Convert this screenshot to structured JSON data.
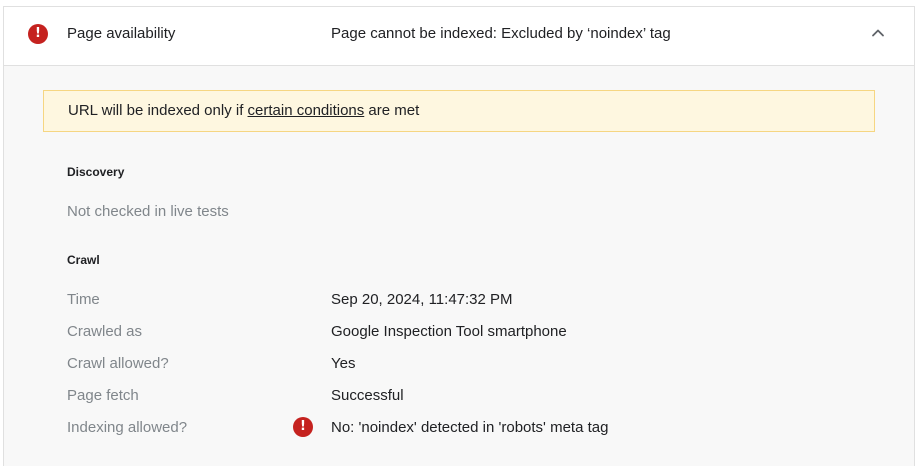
{
  "header": {
    "label": "Page availability",
    "status": "Page cannot be indexed: Excluded by ‘noindex’ tag",
    "icon": "error-icon",
    "collapse_icon": "chevron-up-icon"
  },
  "notice": {
    "prefix": "URL will be indexed only if ",
    "link": "certain conditions",
    "suffix": " are met"
  },
  "discovery": {
    "title": "Discovery",
    "note": "Not checked in live tests"
  },
  "crawl": {
    "title": "Crawl",
    "rows": [
      {
        "label": "Time",
        "value": "Sep 20, 2024, 11:47:32 PM"
      },
      {
        "label": "Crawled as",
        "value": "Google Inspection Tool smartphone"
      },
      {
        "label": "Crawl allowed?",
        "value": "Yes"
      },
      {
        "label": "Page fetch",
        "value": "Successful"
      },
      {
        "label": "Indexing allowed?",
        "value": "No: 'noindex' detected in 'robots' meta tag",
        "status_icon": "error-icon"
      }
    ]
  },
  "colors": {
    "error": "#c5221f",
    "notice_bg": "#fef7e0",
    "notice_border": "#f6d682",
    "muted_text": "#80868b"
  }
}
